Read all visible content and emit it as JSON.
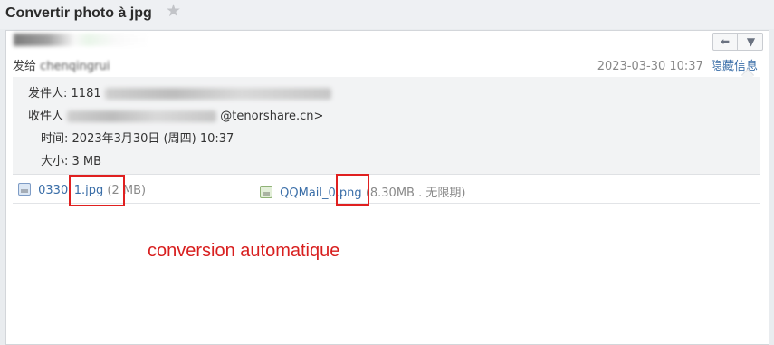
{
  "page": {
    "title": "Convertir photo à jpg"
  },
  "toolbar": {
    "prev_glyph": "⬅",
    "next_glyph": "▼"
  },
  "header": {
    "sent_to_prefix": "发给",
    "sent_to_name": "chenqingrui",
    "date": "2023-03-30 10:37",
    "hide_info_label": "隐藏信息"
  },
  "details": {
    "from_label": "发件人:",
    "from_value": "1181",
    "to_label": "收件人",
    "to_domain": "@tenorshare.cn>",
    "time_label": "时间:",
    "time_value": "2023年3月30日 (周四) 10:37",
    "size_label": "大小:",
    "size_value": "3 MB"
  },
  "attachments": [
    {
      "name": "0330_1.jpg",
      "meta": "(2 MB)",
      "icon": "jpg-file-icon"
    },
    {
      "name": "QQMail_0.png",
      "meta": "(8.30MB . 无限期)",
      "icon": "png-file-icon"
    }
  ],
  "annotation": "conversion automatique",
  "colors": {
    "annotation": "#d81f1f",
    "link": "#3a6ea8",
    "highlight_box": "#e02020"
  }
}
